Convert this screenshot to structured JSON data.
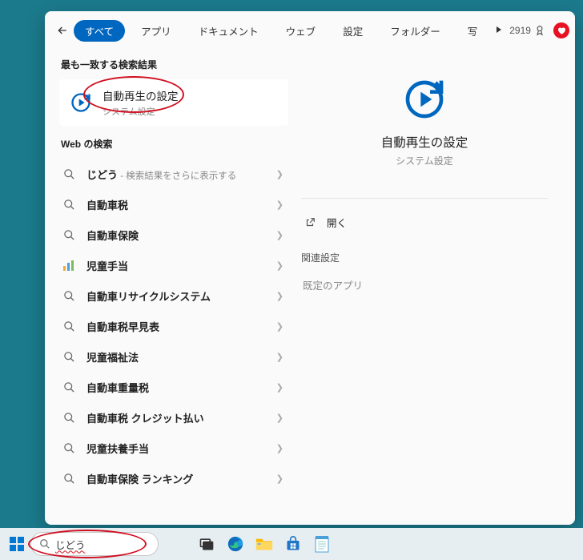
{
  "header": {
    "tabs": [
      {
        "label": "すべて",
        "active": true
      },
      {
        "label": "アプリ",
        "active": false
      },
      {
        "label": "ドキュメント",
        "active": false
      },
      {
        "label": "ウェブ",
        "active": false
      },
      {
        "label": "設定",
        "active": false
      },
      {
        "label": "フォルダー",
        "active": false
      },
      {
        "label": "写",
        "active": false
      }
    ],
    "points": "2919"
  },
  "left": {
    "best_match_heading": "最も一致する検索結果",
    "best_match": {
      "title": "自動再生の設定",
      "subtitle": "システム設定"
    },
    "web_heading": "Web の検索",
    "web_results": [
      {
        "icon": "search",
        "label": "じどう",
        "hint": " - 検索結果をさらに表示する"
      },
      {
        "icon": "search",
        "label": "自動車税",
        "hint": ""
      },
      {
        "icon": "search",
        "label": "自動車保険",
        "hint": ""
      },
      {
        "icon": "chart",
        "label": "児童手当",
        "hint": ""
      },
      {
        "icon": "search",
        "label": "自動車リサイクルシステム",
        "hint": ""
      },
      {
        "icon": "search",
        "label": "自動車税早見表",
        "hint": ""
      },
      {
        "icon": "search",
        "label": "児童福祉法",
        "hint": ""
      },
      {
        "icon": "search",
        "label": "自動車重量税",
        "hint": ""
      },
      {
        "icon": "search",
        "label": "自動車税 クレジット払い",
        "hint": ""
      },
      {
        "icon": "search",
        "label": "児童扶養手当",
        "hint": ""
      },
      {
        "icon": "search",
        "label": "自動車保険 ランキング",
        "hint": ""
      }
    ]
  },
  "right": {
    "title": "自動再生の設定",
    "subtitle": "システム設定",
    "open_label": "開く",
    "related_heading": "関連設定",
    "related_items": [
      "既定のアプリ"
    ]
  },
  "taskbar": {
    "search_value": "じどう"
  }
}
